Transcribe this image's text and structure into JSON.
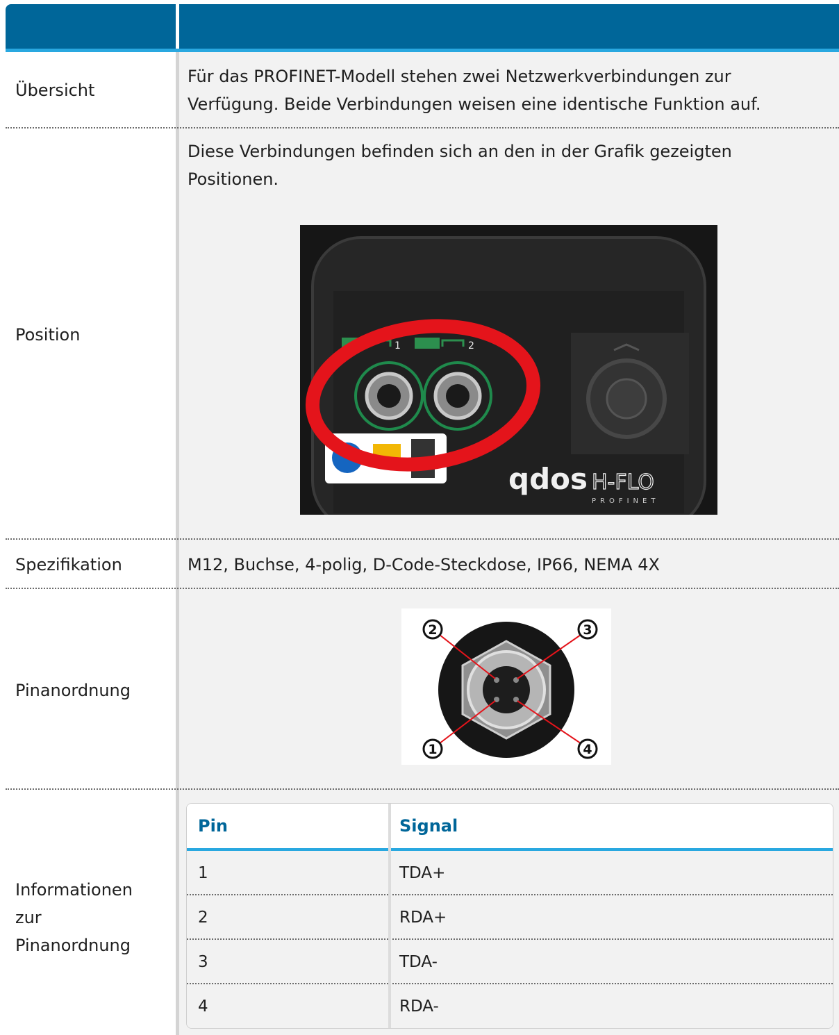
{
  "rows": {
    "overview": {
      "label": "Übersicht",
      "line1": "Für das PROFINET-Modell stehen zwei Netzwerkverbindungen zur",
      "line2": "Verfügung. Beide Verbindungen weisen eine identische Funktion auf."
    },
    "position": {
      "label": "Position",
      "line1": "Diese Verbindungen befinden sich an den in der Grafik gezeigten",
      "line2": "Positionen."
    },
    "spec": {
      "label": "Spezifikation",
      "text": "M12, Buchse, 4-polig, D-Code-Steckdose, IP66, NEMA 4X"
    },
    "pinout": {
      "label": "Pinanordnung"
    },
    "pininfo": {
      "label_l1": "Informationen",
      "label_l2": "zur",
      "label_l3": "Pinanordnung"
    }
  },
  "device_image": {
    "port1": "1",
    "port2": "2",
    "logo_main": "qdos",
    "logo_sub": "H-FLO",
    "logo_tag": "PROFINET"
  },
  "pin_image": {
    "n1": "1",
    "n2": "2",
    "n3": "3",
    "n4": "4"
  },
  "pin_table": {
    "headers": [
      "Pin",
      "Signal"
    ],
    "rows": [
      [
        "1",
        "TDA+"
      ],
      [
        "2",
        "RDA+"
      ],
      [
        "3",
        "TDA-"
      ],
      [
        "4",
        "RDA-"
      ]
    ]
  },
  "colors": {
    "header_blue": "#006699",
    "accent_blue": "#29a8e0",
    "highlight_red": "#e4141b",
    "connector_green": "#1f8a4c"
  }
}
